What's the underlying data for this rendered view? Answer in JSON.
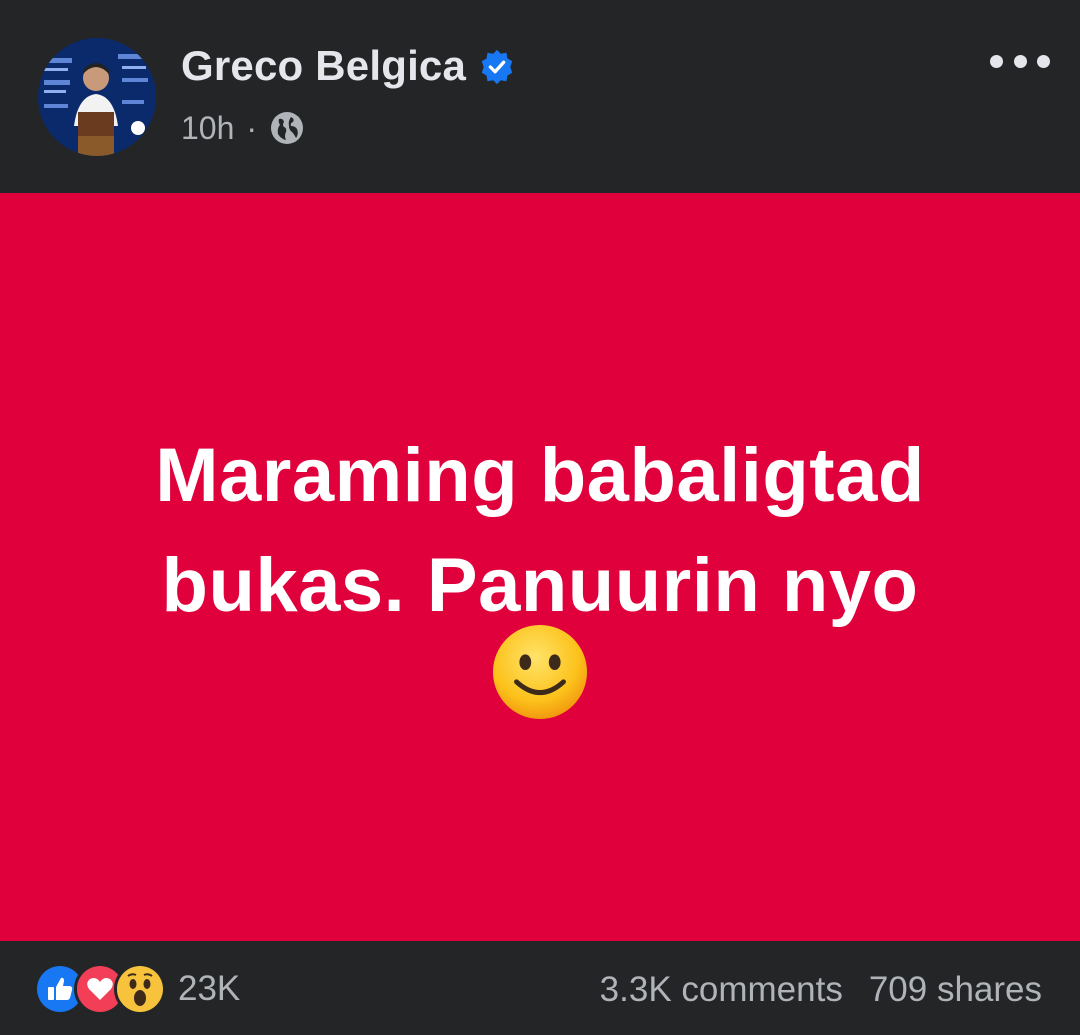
{
  "post": {
    "author": {
      "name": "Greco Belgica",
      "verified": true,
      "avatar_icon": "profile-photo"
    },
    "timestamp": "10h",
    "separator": "·",
    "privacy_icon": "globe-icon",
    "more_icon": "more-options-icon",
    "status": {
      "line1": "Maraming babaligtad",
      "line2": "bukas. Panuurin nyo",
      "emoji_icon": "slightly-smiling-face-emoji",
      "background_color": "#e0003b",
      "text_color": "#ffffff"
    },
    "reactions": {
      "types": [
        "like-icon",
        "love-icon",
        "wow-icon"
      ],
      "count": "23K"
    },
    "comments": "3.3K comments",
    "shares": "709 shares"
  },
  "colors": {
    "surface": "#242526",
    "primary_text": "#e4e6eb",
    "secondary_text": "#b0b3b8",
    "verified_blue": "#1877f2",
    "like_blue": "#1877f2",
    "love_red": "#f33e58"
  }
}
